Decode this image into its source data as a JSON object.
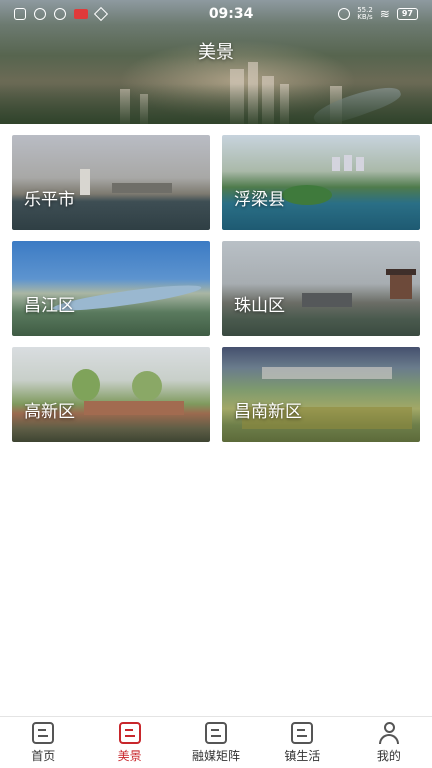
{
  "status_bar": {
    "time": "09:34",
    "network_speed_value": "55.2",
    "network_speed_unit": "KB/s",
    "battery": "97"
  },
  "header": {
    "title": "美景"
  },
  "regions": [
    {
      "label": "乐平市"
    },
    {
      "label": "浮梁县"
    },
    {
      "label": "昌江区"
    },
    {
      "label": "珠山区"
    },
    {
      "label": "高新区"
    },
    {
      "label": "昌南新区"
    }
  ],
  "nav": {
    "items": [
      {
        "label": "首页",
        "icon": "home-icon"
      },
      {
        "label": "美景",
        "icon": "scenery-icon",
        "active": true
      },
      {
        "label": "融媒矩阵",
        "icon": "media-icon"
      },
      {
        "label": "镇生活",
        "icon": "town-life-icon"
      },
      {
        "label": "我的",
        "icon": "user-icon"
      }
    ],
    "active_color": "#c8262b"
  }
}
